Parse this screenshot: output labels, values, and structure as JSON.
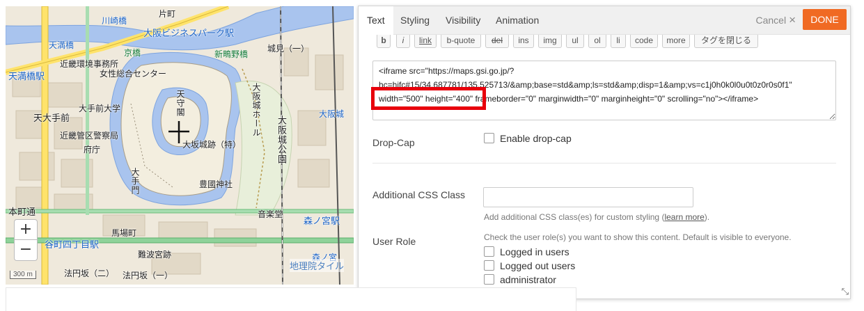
{
  "map": {
    "labels": [
      {
        "text": "川崎橋",
        "cls": "blue"
      },
      {
        "text": "片町",
        "cls": ""
      },
      {
        "text": "大阪ビジネスパーク駅",
        "cls": "blue big"
      },
      {
        "text": "天満橋",
        "cls": "blue"
      },
      {
        "text": "京橋",
        "cls": "green"
      },
      {
        "text": "新鴫野橋",
        "cls": "green"
      },
      {
        "text": "城見（一）",
        "cls": ""
      },
      {
        "text": "近畿環境事務所",
        "cls": ""
      },
      {
        "text": "女性総合センター",
        "cls": ""
      },
      {
        "text": "天満橋駅",
        "cls": "blue big"
      },
      {
        "text": "天守閣",
        "cls": "vert"
      },
      {
        "text": "大阪城ホール",
        "cls": "vert"
      },
      {
        "text": "大手前大学",
        "cls": ""
      },
      {
        "text": "天大手前",
        "cls": "big"
      },
      {
        "text": "近畿管区警察局",
        "cls": ""
      },
      {
        "text": "大阪城公園",
        "cls": "vert big"
      },
      {
        "text": "大坂城跡（特）",
        "cls": ""
      },
      {
        "text": "府庁",
        "cls": ""
      },
      {
        "text": "大手門",
        "cls": "vert"
      },
      {
        "text": "豊國神社",
        "cls": ""
      },
      {
        "text": "大阪城",
        "cls": "blue"
      },
      {
        "text": "本町通",
        "cls": "big"
      },
      {
        "text": "音楽堂",
        "cls": ""
      },
      {
        "text": "森ノ宮駅",
        "cls": "blue big"
      },
      {
        "text": "馬場町",
        "cls": ""
      },
      {
        "text": "谷町四丁目駅",
        "cls": "blue big"
      },
      {
        "text": "難波宮跡",
        "cls": ""
      },
      {
        "text": "森ノ宮",
        "cls": "blue"
      },
      {
        "text": "法円坂（二）",
        "cls": ""
      },
      {
        "text": "法円坂（一）",
        "cls": ""
      }
    ],
    "zoom_in": "+",
    "zoom_out": "−",
    "attribution": "地理院タイル",
    "scale": "300 m"
  },
  "panel": {
    "tabs": [
      "Text",
      "Styling",
      "Visibility",
      "Animation"
    ],
    "active_tab": "Text",
    "cancel_label": "Cancel",
    "cancel_icon": "×",
    "done_label": "DONE",
    "toolbar": [
      "b",
      "i",
      "link",
      "b-quote",
      "del",
      "ins",
      "img",
      "ul",
      "ol",
      "li",
      "code",
      "more",
      "タグを閉じる"
    ],
    "code_lines": [
      "<iframe src=\"https://maps.gsi.go.jp/?",
      "hc=hifc#15/34.687781/135.525713/&amp;base=std&amp;ls=std&amp;disp=1&amp;vs=c1j0h0k0l0u0t0z0r0s0f1\"",
      "width=\"500\" height=\"400\" frameborder=\"0\" marginwidth=\"0\" marginheight=\"0\" scrolling=\"no\"></iframe>"
    ],
    "dropcap": {
      "label": "Drop-Cap",
      "checkbox": "Enable drop-cap"
    },
    "css_class": {
      "label": "Additional CSS Class",
      "value": "",
      "help_prefix": "Add additional CSS class(es) for custom styling (",
      "help_link": "learn more",
      "help_suffix": ")."
    },
    "user_role": {
      "label": "User Role",
      "help": "Check the user role(s) you want to show this content. Default is visible to everyone.",
      "options": [
        "Logged in users",
        "Logged out users",
        "administrator"
      ]
    }
  },
  "colors": {
    "accent": "#f06a23",
    "highlight": "#e8000c"
  }
}
